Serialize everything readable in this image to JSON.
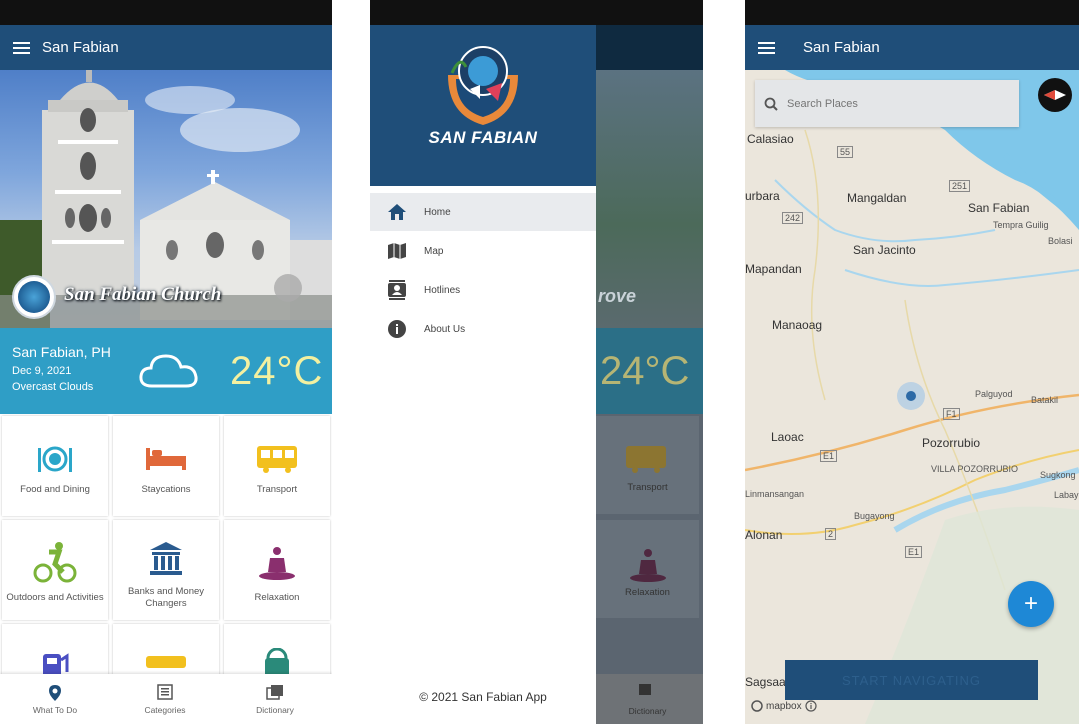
{
  "screen_home": {
    "app_title": "San Fabian",
    "hero_caption": "San Fabian Church",
    "weather": {
      "place": "San Fabian, PH",
      "date": "Dec 9, 2021",
      "condition": "Overcast Clouds",
      "temperature": "24°C"
    },
    "categories": [
      {
        "label": "Food and Dining",
        "icon": "dining-icon",
        "color": "#2aa6c9"
      },
      {
        "label": "Staycations",
        "icon": "bed-icon",
        "color": "#e0683a"
      },
      {
        "label": "Transport",
        "icon": "bus-icon",
        "color": "#f2c01e"
      },
      {
        "label": "Outdoors and Activities",
        "icon": "cyclist-icon",
        "color": "#7bb339"
      },
      {
        "label": "Banks and Money Changers",
        "icon": "bank-icon",
        "color": "#2a5b8f"
      },
      {
        "label": "Relaxation",
        "icon": "meditation-icon",
        "color": "#8a2f6e"
      }
    ],
    "bottom_nav": [
      {
        "label": "What To Do",
        "icon": "location-pin-icon"
      },
      {
        "label": "Categories",
        "icon": "list-icon"
      },
      {
        "label": "Dictionary",
        "icon": "book-icon"
      }
    ]
  },
  "screen_drawer": {
    "logo_text": "SAN FABIAN",
    "items": [
      {
        "label": "Home",
        "icon": "home-icon"
      },
      {
        "label": "Map",
        "icon": "map-icon"
      },
      {
        "label": "Hotlines",
        "icon": "contacts-icon"
      },
      {
        "label": "About Us",
        "icon": "info-icon"
      }
    ],
    "copyright": "© 2021 San Fabian App",
    "background_partial": {
      "caption": "rove",
      "temperature": "24°C",
      "transport": "Transport",
      "relaxation": "Relaxation",
      "dictionary": "Dictionary"
    }
  },
  "screen_map": {
    "app_title": "San Fabian",
    "search_placeholder": "Search Places",
    "places": [
      "Calasiao",
      "Mangaldan",
      "San Fabian",
      "Tempra Guilig",
      "Bolasi",
      "San Jacinto",
      "Mapandan",
      "Manaoag",
      "Palguyod",
      "Batakil",
      "Laoac",
      "Pozorrubio",
      "VILLA POZORRUBIO",
      "Sugkong",
      "Labayug",
      "Linmansangan",
      "Bugayong",
      "Alonan",
      "Sagsaag",
      "urbara"
    ],
    "road_labels": [
      "55",
      "251",
      "242",
      "F1",
      "E1",
      "E1",
      "2"
    ],
    "start_button": "START NAVIGATING",
    "attribution": "mapbox"
  },
  "colors": {
    "appbar": "#1f4e79",
    "weather_band": "#2f9ec6",
    "fab": "#1e88d6"
  }
}
